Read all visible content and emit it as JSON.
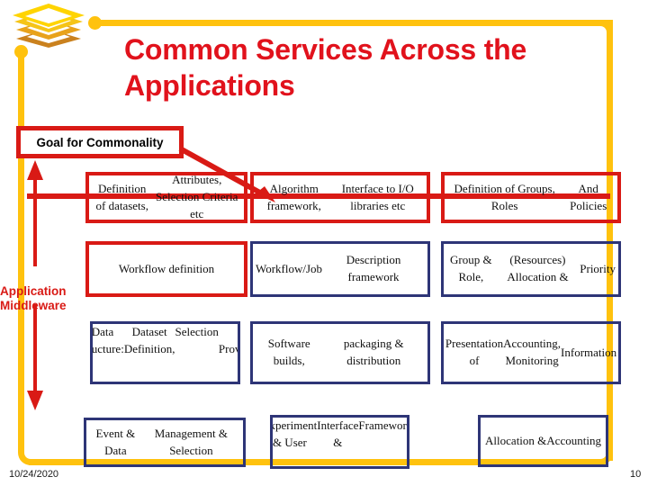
{
  "slide": {
    "title": "Common Services Across the Applications",
    "callout_label": "Goal for Commonality",
    "side_label": "Application\nMiddleware",
    "side_label_line1": "Application",
    "side_label_line2": "Middleware",
    "footer_date": "10/24/2020",
    "footer_page": "10"
  },
  "colors": {
    "title_red": "#E1121C",
    "accent_red": "#D91A15",
    "navy": "#2E3577",
    "frame_yellow": "#FFC20E"
  },
  "icons": {
    "logo": "layered-diamond-logo",
    "leader_arrow": "arrow-down-right-icon",
    "up_arrow": "arrow-up-icon",
    "down_arrow": "arrow-down-icon"
  },
  "matrix": {
    "rows": [
      {
        "cells": [
          {
            "text": "Definition of datasets,\nAttributes, Selection Criteria etc",
            "border": "red"
          },
          {
            "text": "Algorithm framework,\nInterface to I/O libraries etc",
            "border": "red"
          },
          {
            "text": "Definition of Groups, Roles\nAnd Policies",
            "border": "red"
          }
        ]
      },
      {
        "cells": [
          {
            "text": "Workflow definition",
            "border": "red"
          },
          {
            "text": "Workflow/Job\nDescription framework",
            "border": "navy"
          },
          {
            "text": "Group & Role,\n(Resources) Allocation &\nPriority",
            "border": "navy"
          }
        ]
      },
      {
        "cells": [
          {
            "text": "MetaData Infrastructure:\nDataset Definition,\nSelection\nand Provenance",
            "border": "navy"
          },
          {
            "text": "Software builds,\npackaging & distribution",
            "border": "navy"
          },
          {
            "text": "Presentation of\nAccounting, Monitoring\nInformation",
            "border": "navy"
          }
        ]
      },
      {
        "cells": [
          {
            "text": "Event & Data\nManagement &  Selection",
            "border": "navy"
          },
          {
            "text": "Experiment & User\nInterface &\nFrameworks",
            "border": "navy"
          },
          {
            "text": "Allocation &\nAccounting",
            "border": "navy"
          }
        ]
      }
    ]
  }
}
